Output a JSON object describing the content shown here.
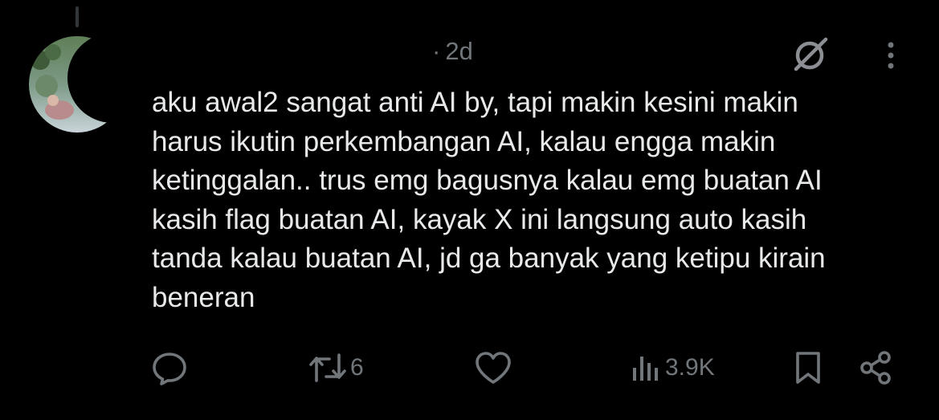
{
  "post": {
    "time_separator": "·",
    "time": "2d",
    "text_lines": [
      "aku awal2 sangat anti AI by, tapi makin kesini makin",
      "harus ikutin perkembangan AI, kalau engga makin",
      "ketinggalan.. trus emg bagusnya kalau emg buatan AI",
      "kasih flag buatan AI, kayak X ini langsung auto kasih",
      "tanda kalau buatan AI, jd ga banyak yang ketipu kirain",
      "beneran"
    ]
  },
  "actions": {
    "reply_count": "",
    "retweet_count": "6",
    "like_count": "",
    "views_count": "3.9K"
  },
  "icons": {
    "grok": "grok-icon",
    "more": "more-dots-icon",
    "reply": "reply-icon",
    "retweet": "retweet-icon",
    "like": "heart-icon",
    "views": "views-icon",
    "bookmark": "bookmark-icon",
    "share": "share-icon"
  },
  "colors": {
    "background": "#000000",
    "text": "#e7e9ea",
    "secondary": "#71767b",
    "thread_line": "#333639"
  }
}
